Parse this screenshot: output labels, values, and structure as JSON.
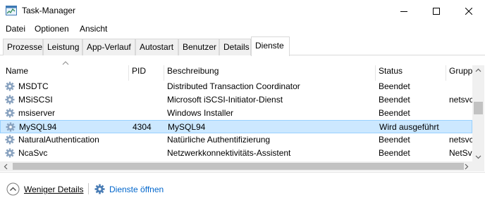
{
  "window": {
    "title": "Task-Manager",
    "app_icon": "task-manager-icon",
    "controls": {
      "minimize": "minimize-icon",
      "maximize": "maximize-icon",
      "close": "close-icon"
    }
  },
  "menu": [
    "Datei",
    "Optionen",
    "Ansicht"
  ],
  "tabs": [
    {
      "label": "Prozesse",
      "active": false
    },
    {
      "label": "Leistung",
      "active": false
    },
    {
      "label": "App-Verlauf",
      "active": false
    },
    {
      "label": "Autostart",
      "active": false
    },
    {
      "label": "Benutzer",
      "active": false
    },
    {
      "label": "Details",
      "active": false
    },
    {
      "label": "Dienste",
      "active": true
    }
  ],
  "table": {
    "sort_icon": "sort-ascending-icon",
    "columns": [
      "Name",
      "PID",
      "Beschreibung",
      "Status",
      "Gruppe"
    ],
    "rows": [
      {
        "name": "MSDTC",
        "pid": "",
        "description": "Distributed Transaction Coordinator",
        "status": "Beendet",
        "group": "",
        "selected": false
      },
      {
        "name": "MSiSCSI",
        "pid": "",
        "description": "Microsoft iSCSI-Initiator-Dienst",
        "status": "Beendet",
        "group": "netsvcs",
        "selected": false
      },
      {
        "name": "msiserver",
        "pid": "",
        "description": "Windows Installer",
        "status": "Beendet",
        "group": "",
        "selected": false
      },
      {
        "name": "MySQL94",
        "pid": "4304",
        "description": "MySQL94",
        "status": "Wird ausgeführt",
        "group": "",
        "selected": true
      },
      {
        "name": "NaturalAuthentication",
        "pid": "",
        "description": "Natürliche Authentifizierung",
        "status": "Beendet",
        "group": "netsvcs",
        "selected": false
      },
      {
        "name": "NcaSvc",
        "pid": "",
        "description": "Netzwerkkonnektivitäts-Assistent",
        "status": "Beendet",
        "group": "NetSvcs",
        "selected": false
      }
    ]
  },
  "footer": {
    "fewer_details": "Weniger Details",
    "open_services": "Dienste öffnen",
    "fewer_icon": "chevron-up-circle-icon",
    "services_icon": "gear-icon"
  },
  "colors": {
    "selected_row": "#cce8ff",
    "selected_border": "#99d1ff",
    "link": "#0066cc",
    "icon_gear": "#4a7db5"
  }
}
